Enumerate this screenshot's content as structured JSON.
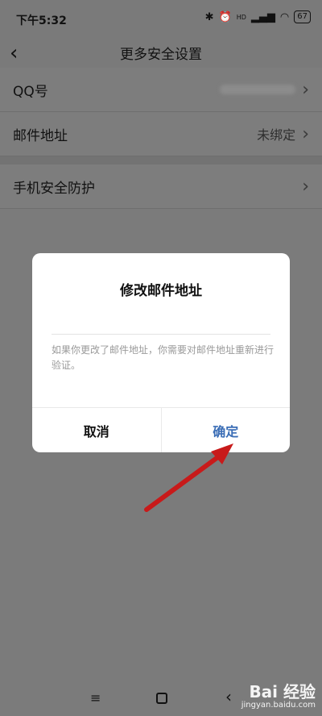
{
  "status_bar": {
    "time": "下午5:32",
    "hd_badge": "HD",
    "battery": "67"
  },
  "navbar": {
    "title": "更多安全设置"
  },
  "settings": {
    "qq_label": "QQ号",
    "email_label": "邮件地址",
    "email_value": "未绑定",
    "phone_protect_label": "手机安全防护"
  },
  "dialog": {
    "title": "修改邮件地址",
    "message": "如果你更改了邮件地址，你需要对邮件地址重新进行验证。",
    "cancel_label": "取消",
    "confirm_label": "确定"
  },
  "watermark": {
    "main": "Bai 经验",
    "sub": "jingyan.baidu.com"
  },
  "colors": {
    "dim_background": "#7b7b7b",
    "confirm_text": "#3b6eb6",
    "arrow": "#c81a1a"
  }
}
